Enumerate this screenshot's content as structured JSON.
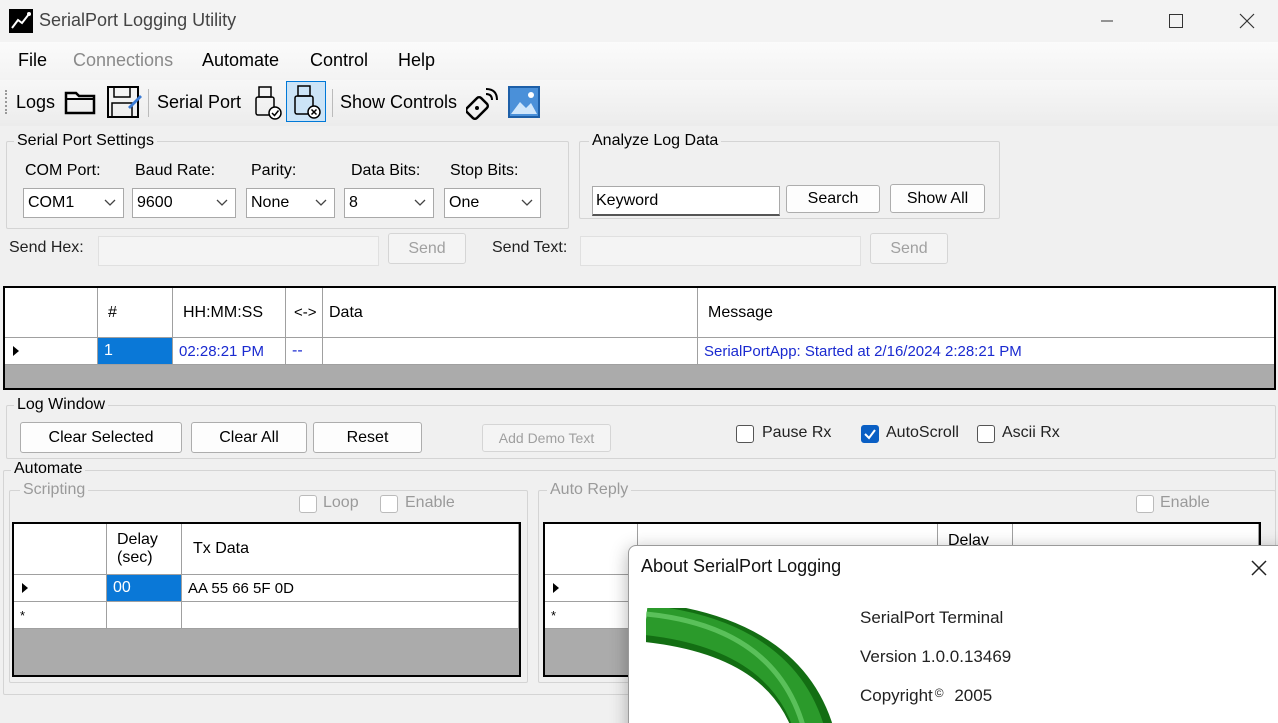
{
  "window": {
    "title": "SerialPort Logging Utility"
  },
  "menu": [
    "File",
    "Connections",
    "Automate",
    "Control",
    "Help"
  ],
  "toolbar": {
    "logs": "Logs",
    "serial_port": "Serial Port",
    "show_controls": "Show Controls"
  },
  "serial_settings": {
    "title": "Serial Port Settings",
    "com_label": "COM Port:",
    "com_value": "COM1",
    "baud_label": "Baud Rate:",
    "baud_value": "9600",
    "parity_label": "Parity:",
    "parity_value": "None",
    "databits_label": "Data Bits:",
    "databits_value": "8",
    "stopbits_label": "Stop Bits:",
    "stopbits_value": "One"
  },
  "analyze": {
    "title": "Analyze Log Data",
    "keyword": "Keyword",
    "search": "Search",
    "show_all": "Show All"
  },
  "send": {
    "hex_label": "Send Hex:",
    "text_label": "Send Text:",
    "send": "Send"
  },
  "log_grid": {
    "headers": [
      "#",
      "HH:MM:SS",
      "<->",
      "Data",
      "Message"
    ],
    "row": {
      "num": "1",
      "time": "02:28:21 PM",
      "dir": "--",
      "data": "",
      "message": "SerialPortApp: Started at 2/16/2024 2:28:21 PM"
    }
  },
  "log_window": {
    "title": "Log Window",
    "clear_selected": "Clear Selected",
    "clear_all": "Clear All",
    "reset": "Reset",
    "demo": "Add Demo Text",
    "pause_rx": "Pause Rx",
    "autoscroll": "AutoScroll",
    "ascii_rx": "Ascii Rx"
  },
  "automate": {
    "title": "Automate",
    "scripting": "Scripting",
    "loop": "Loop",
    "enable": "Enable",
    "auto_reply": "Auto Reply",
    "script_headers": [
      "Delay\n(sec)",
      "Tx Data"
    ],
    "script_row": {
      "delay": "00",
      "tx": "AA 55 66 5F 0D"
    },
    "reply_header_delay": "Delay"
  },
  "about": {
    "title": "About SerialPort Logging",
    "product": "SerialPort Terminal",
    "version": "Version 1.0.0.13469",
    "copyright": "Copyright",
    "copyright_year": "2005"
  },
  "colors": {
    "accent": "#0a78d7",
    "link_blue": "#1a2ad0",
    "logo_green": "#2b9a2b"
  }
}
